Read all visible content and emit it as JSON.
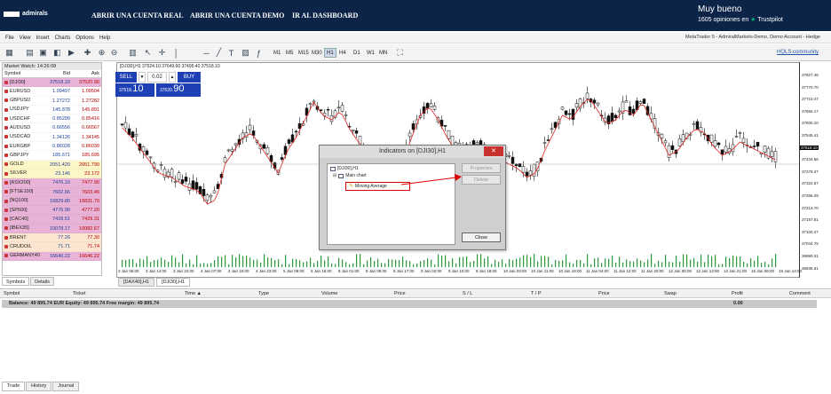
{
  "banner": {
    "logo_text": "admirals",
    "logo_small": "ADMIRAL MARKETS",
    "nav": [
      "ABRIR UNA CUENTA REAL",
      "ABRIR UNA CUENTA DEMO",
      "IR AL DASHBOARD"
    ],
    "rating_label": "Muy bueno",
    "reviews_text": "1605 opiniones en",
    "trustpilot": "Trustpilot"
  },
  "menu": [
    "File",
    "View",
    "Insert",
    "Charts",
    "Options",
    "Help"
  ],
  "account_info": "MetaTrader 5 -                AdmiralMarkets-Demo, Demo Account - Hedge",
  "toolbar": {
    "timeframes": [
      "M1",
      "M5",
      "M15",
      "M30",
      "H1",
      "H4",
      "D1",
      "W1",
      "MN"
    ],
    "selected_timeframe": "H1",
    "hqls_link": "HQLS.community"
  },
  "market_watch": {
    "title": "Market Watch: 14:26:08",
    "headers": [
      "Symbol",
      "Bid",
      "Ask"
    ],
    "rows": [
      {
        "symbol": "[DJI30]",
        "bid": "37518.10",
        "ask": "37520.90",
        "bg": "#e8b3d6"
      },
      {
        "symbol": "EURUSD",
        "bid": "1.09497",
        "ask": "1.09504",
        "bg": "#ffffff"
      },
      {
        "symbol": "GBPUSD",
        "bid": "1.27272",
        "ask": "1.27282",
        "bg": "#ffffff"
      },
      {
        "symbol": "USDJPY",
        "bid": "145.878",
        "ask": "145.891",
        "bg": "#ffffff"
      },
      {
        "symbol": "USDCHF",
        "bid": "0.85299",
        "ask": "0.85416",
        "bg": "#ffffff"
      },
      {
        "symbol": "AUDUSD",
        "bid": "0.66556",
        "ask": "0.66567",
        "bg": "#ffffff"
      },
      {
        "symbol": "USDCAD",
        "bid": "1.34126",
        "ask": "1.34145",
        "bg": "#ffffff"
      },
      {
        "symbol": "EURGBP",
        "bid": "0.86028",
        "ask": "0.86039",
        "bg": "#ffffff"
      },
      {
        "symbol": "GBPJPY",
        "bid": "185.671",
        "ask": "185.695",
        "bg": "#ffffff"
      },
      {
        "symbol": "GOLD",
        "bid": "2051.420",
        "ask": "2051.790",
        "bg": "#fdf6c6"
      },
      {
        "symbol": "SILVER",
        "bid": "23.146",
        "ask": "23.172",
        "bg": "#fdf6c6"
      },
      {
        "symbol": "[ASX200]",
        "bid": "7476.10",
        "ask": "7477.90",
        "bg": "#e8b3d6"
      },
      {
        "symbol": "[FTSE100]",
        "bid": "7602.66",
        "ask": "7603.46",
        "bg": "#e8b3d6"
      },
      {
        "symbol": "[NQ100]",
        "bid": "16829.80",
        "ask": "16831.70",
        "bg": "#e8b3d6"
      },
      {
        "symbol": "[SP500]",
        "bid": "4776.90",
        "ask": "4777.20",
        "bg": "#e8b3d6"
      },
      {
        "symbol": "[CAC40]",
        "bid": "7428.51",
        "ask": "7429.31",
        "bg": "#e8b3d6"
      },
      {
        "symbol": "[IBEX35]",
        "bid": "10078.17",
        "ask": "10082.67",
        "bg": "#e8b3d6"
      },
      {
        "symbol": "BRENT",
        "bid": "77.26",
        "ask": "77.30",
        "bg": "#fbe5d0"
      },
      {
        "symbol": "CRUDOIL",
        "bid": "71.71",
        "ask": "71.74",
        "bg": "#fbe5d0"
      },
      {
        "symbol": "GERMANY40",
        "bid": "16640.22",
        "ask": "16646.22",
        "bg": "#e8b3d6"
      }
    ],
    "tabs": [
      "Symbols",
      "Details"
    ]
  },
  "chart": {
    "title": "[DJI30],H1  37524.10 37649.60 37495.40 37518.10",
    "sell_label": "SELL",
    "buy_label": "BUY",
    "volume": "0.02",
    "sell_price_small": "37518.",
    "sell_price_big": "10",
    "buy_price_small": "37520.",
    "buy_price_big": "90",
    "y_labels": [
      "37827.46",
      "37770.70",
      "37710.47",
      "37655.17",
      "37600.10",
      "37545.41",
      "37518.10",
      "37434.56",
      "37379.27",
      "37322.67",
      "37266.29",
      "37213.70",
      "37157.81",
      "37100.47",
      "37044.75",
      "36990.31",
      "36935.61"
    ],
    "current_price": "37518.10",
    "x_labels": [
      "3 Jan 06:00",
      "3 Jan 14:00",
      "3 Jan 22:00",
      "4 Jan 07:00",
      "4 Jan 15:00",
      "4 Jan 23:00",
      "5 Jan 08:00",
      "5 Jan 16:00",
      "8 Jan 01:00",
      "8 Jan 09:00",
      "8 Jan 17:00",
      "9 Jan 02:00",
      "9 Jan 10:00",
      "9 Jan 18:00",
      "10 Jan 03:00",
      "10 Jan 11:00",
      "10 Jan 19:00",
      "11 Jan 04:00",
      "11 Jan 12:00",
      "11 Jan 20:00",
      "12 Jan 05:00",
      "12 Jan 13:00",
      "12 Jan 21:00",
      "15 Jan 06:00",
      "15 Jan 14:00"
    ],
    "tabs": [
      "[DAX40],H1",
      "[DJI30],H1"
    ],
    "active_tab": "[DJI30],H1"
  },
  "dialog": {
    "title": "Indicators on [DJI30],H1",
    "close_x": "✕",
    "tree_root": "[DJI30],H1",
    "tree_node": "Main chart",
    "tree_item": "Moving Average",
    "btn_properties": "Properties",
    "btn_delete": "Delete",
    "btn_close": "Close"
  },
  "terminal": {
    "headers": [
      "Symbol",
      "Ticket",
      "Time ▲",
      "Type",
      "Volume",
      "Price",
      "S / L",
      "T / P",
      "Price",
      "Swap",
      "Profit",
      "Comment"
    ],
    "balance_text": "Balance: 49 895.74 EUR  Equity: 49 895.74  Free margin: 49 895.74",
    "profit_total": "0.00",
    "tabs": [
      "Trade",
      "History",
      "Journal"
    ]
  }
}
